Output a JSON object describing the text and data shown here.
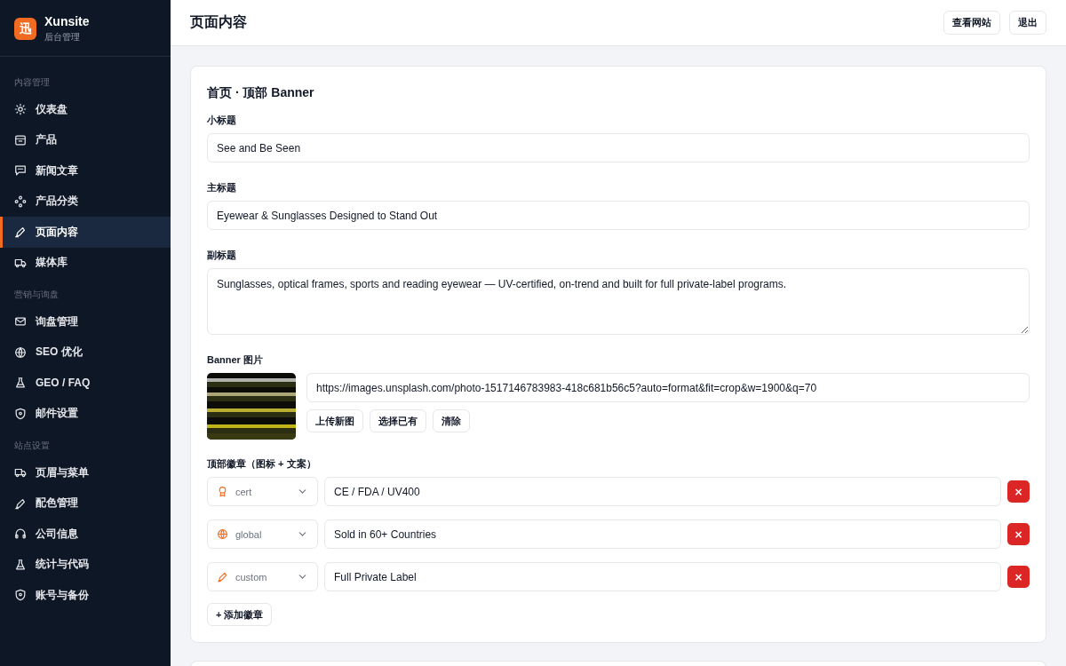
{
  "brand": {
    "name": "Xunsite",
    "logo": "迅",
    "subtitle": "后台管理"
  },
  "sidebar": {
    "sections": [
      {
        "label": "内容管理",
        "items": [
          {
            "label": "仪表盘",
            "selected": false
          },
          {
            "label": "产品",
            "selected": false
          },
          {
            "label": "新闻文章",
            "selected": false
          },
          {
            "label": "产品分类",
            "selected": false
          },
          {
            "label": "页面内容",
            "selected": true
          },
          {
            "label": "媒体库",
            "selected": false
          }
        ]
      },
      {
        "label": "营销与询盘",
        "items": [
          {
            "label": "询盘管理",
            "selected": false
          },
          {
            "label": "SEO 优化",
            "selected": false
          },
          {
            "label": "GEO / FAQ",
            "selected": false
          },
          {
            "label": "邮件设置",
            "selected": false
          }
        ]
      },
      {
        "label": "站点设置",
        "items": [
          {
            "label": "页眉与菜单",
            "selected": false
          },
          {
            "label": "配色管理",
            "selected": false
          },
          {
            "label": "公司信息",
            "selected": false
          },
          {
            "label": "统计与代码",
            "selected": false
          },
          {
            "label": "账号与备份",
            "selected": false
          }
        ]
      }
    ]
  },
  "header": {
    "title": "页面内容",
    "buttons": [
      "查看网站",
      "退出"
    ]
  },
  "card": {
    "title": "首页 · 顶部 Banner",
    "fields": [
      {
        "label": "小标题",
        "kind": "input",
        "value": "See and Be Seen"
      },
      {
        "label": "主标题",
        "kind": "input",
        "value": "Eyewear & Sunglasses Designed to Stand Out"
      },
      {
        "label": "副标题",
        "kind": "textarea",
        "value": "Sunglasses, optical frames, sports and reading eyewear — UV-certified, on-trend and built for full private-label programs."
      }
    ],
    "banner": {
      "label": "Banner 图片",
      "image": {
        "kind": "picture"
      },
      "url": "https://images.unsplash.com/photo-1517146783983-418c681b56c5?auto=format&fit=crop&w=1900&q=70",
      "buttons": [
        "上传新图",
        "选择已有",
        "清除"
      ]
    },
    "badges": {
      "label": "顶部徽章（图标 + 文案）",
      "items": [
        {
          "icon": "cert",
          "text": "CE / FDA / UV400",
          "delete": "×"
        },
        {
          "icon": "global",
          "text": "Sold in 60+ Countries",
          "delete": "×"
        },
        {
          "icon": "custom",
          "text": "Full Private Label",
          "delete": "×"
        }
      ],
      "add": "+ 添加徽章"
    }
  }
}
